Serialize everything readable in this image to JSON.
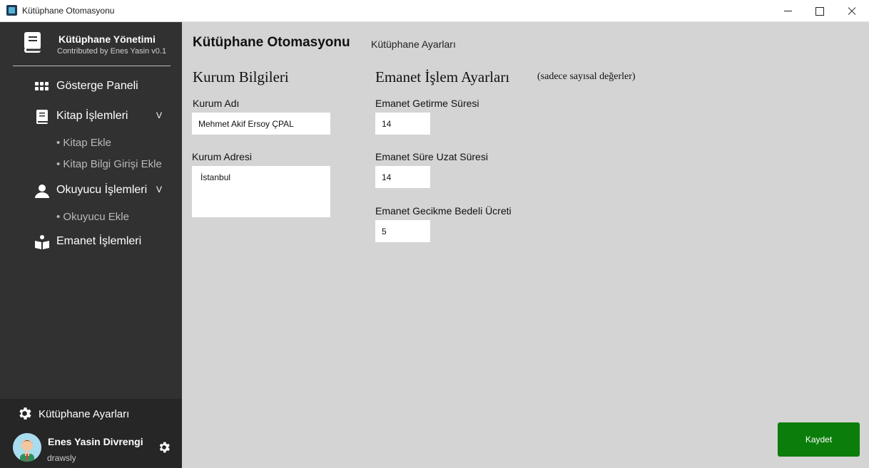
{
  "window": {
    "title": "Kütüphane Otomasyonu"
  },
  "sidebar": {
    "brand_title": "Kütüphane Yönetimi",
    "brand_subtitle": "Contributed by Enes Yasin v0.1",
    "items": [
      {
        "label": "Gösterge Paneli",
        "icon": "grid-icon"
      },
      {
        "label": "Kitap İşlemleri",
        "icon": "book-icon",
        "chevron": "V",
        "children": [
          "• Kitap Ekle",
          "• Kitap Bilgi Girişi Ekle"
        ]
      },
      {
        "label": "Okuyucu İşlemleri",
        "icon": "user-icon",
        "chevron": "V",
        "children": [
          "• Okuyucu Ekle"
        ]
      },
      {
        "label": "Emanet İşlemleri",
        "icon": "reader-icon"
      }
    ],
    "settings_label": "Kütüphane Ayarları",
    "user": {
      "name": "Enes Yasin Divrengi",
      "handle": "drawsly"
    }
  },
  "main": {
    "title": "Kütüphane Otomasyonu",
    "subtitle": "Kütüphane Ayarları",
    "institution": {
      "title": "Kurum Bilgileri",
      "name_label": "Kurum Adı",
      "name_value": "Mehmet Akif Ersoy ÇPAL",
      "address_label": "Kurum Adresi",
      "address_value": "İstanbul"
    },
    "loan": {
      "title": "Emanet İşlem Ayarları",
      "note": "(sadece sayısal değerler)",
      "return_label": "Emanet Getirme Süresi",
      "return_value": "14",
      "extend_label": "Emanet Süre Uzat Süresi",
      "extend_value": "14",
      "fee_label": "Emanet Gecikme Bedeli Ücreti",
      "fee_value": "5"
    },
    "save_label": "Kaydet"
  },
  "colors": {
    "sidebar_bg": "#313131",
    "main_bg": "#d4d4d4",
    "save_button": "#0a7d0a"
  }
}
